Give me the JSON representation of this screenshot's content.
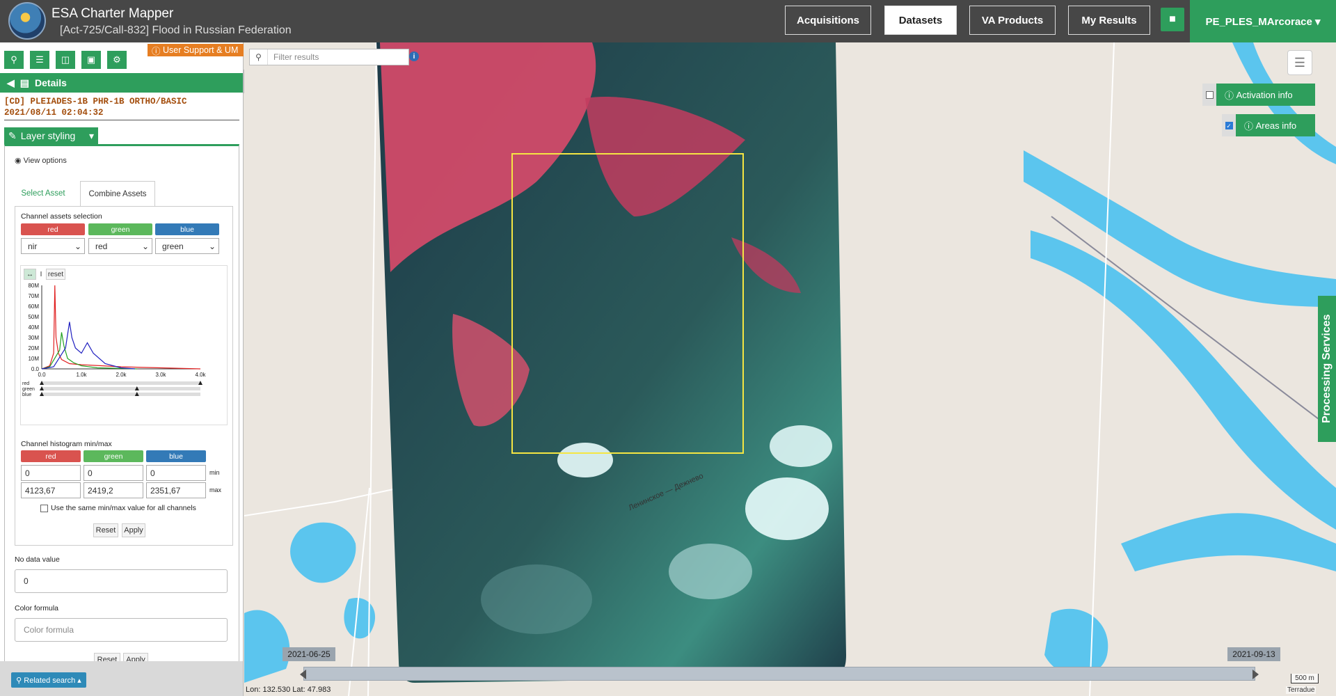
{
  "header": {
    "app_title": "ESA Charter Mapper",
    "activation_title": "[Act-725/Call-832] Flood in Russian Federation",
    "nav": [
      "Acquisitions",
      "Datasets",
      "VA Products",
      "My Results"
    ],
    "active_nav": "Datasets",
    "user": "PE_PLES_MArcorace ▾"
  },
  "sidebar": {
    "support_label": "User Support & UM",
    "details_label": "Details",
    "item_title": "[CD] PLEIADES-1B PHR-1B ORTHO/BASIC 2021/08/11 02:04:32",
    "layer_styling_label": "Layer styling",
    "view_options_label": "View options",
    "tabs": [
      "Select Asset",
      "Combine Assets"
    ],
    "channel_assets_label": "Channel assets selection",
    "channels": [
      "red",
      "green",
      "blue"
    ],
    "channel_values": [
      "nir",
      "red",
      "green"
    ],
    "hist_reset": "reset",
    "hist_mode": "I",
    "minmax_label": "Channel histogram min/max",
    "min": [
      "0",
      "0",
      "0"
    ],
    "max": [
      "4123,67",
      "2419,2",
      "2351,67"
    ],
    "min_label": "min",
    "max_label": "max",
    "same_minmax_label": "Use the same min/max value for all channels",
    "reset_label": "Reset",
    "apply_label": "Apply",
    "nodata_label": "No data value",
    "nodata_value": "0",
    "color_formula_label": "Color formula",
    "color_formula_placeholder": "Color formula",
    "related_search": "Related search ▴",
    "slider_labels": [
      "red",
      "green",
      "blue"
    ]
  },
  "map": {
    "filter_placeholder": "Filter results",
    "activation_info": "Activation info",
    "areas_info": "Areas info",
    "activation_checked": false,
    "areas_checked": true,
    "processing_services": "Processing Services",
    "timeline_start": "2021-06-25",
    "timeline_end": "2021-09-13",
    "coords": "Lon: 132.530 Lat: 47.983",
    "scale": "500 m",
    "attribution": "Terradue",
    "road_label": "Ленинское — Дежнево"
  },
  "chart_data": {
    "type": "line",
    "xlabel": "",
    "ylabel": "",
    "x_ticks": [
      "0.0",
      "1.0k",
      "2.0k",
      "3.0k",
      "4.0k"
    ],
    "y_ticks": [
      "0.0",
      "10M",
      "20M",
      "30M",
      "40M",
      "50M",
      "60M",
      "70M",
      "80M"
    ],
    "xlim": [
      0,
      4000
    ],
    "ylim": [
      0,
      80
    ],
    "series": [
      {
        "name": "red",
        "color": "#e02020",
        "x": [
          0,
          200,
          300,
          330,
          360,
          420,
          500,
          700,
          1000,
          1500,
          2000,
          3000,
          4000
        ],
        "y": [
          0,
          3,
          15,
          80,
          30,
          15,
          9,
          5,
          4,
          3,
          2,
          1,
          0
        ]
      },
      {
        "name": "green",
        "color": "#20a020",
        "x": [
          0,
          200,
          450,
          500,
          560,
          650,
          800,
          1000,
          1400,
          2000,
          2400
        ],
        "y": [
          0,
          2,
          18,
          35,
          22,
          10,
          6,
          3,
          1,
          0.5,
          0
        ]
      },
      {
        "name": "blue",
        "color": "#2020c0",
        "x": [
          0,
          300,
          600,
          700,
          760,
          850,
          1000,
          1150,
          1300,
          1600,
          2000,
          2350
        ],
        "y": [
          0,
          2,
          20,
          45,
          30,
          20,
          15,
          25,
          15,
          5,
          1,
          0
        ]
      }
    ]
  }
}
